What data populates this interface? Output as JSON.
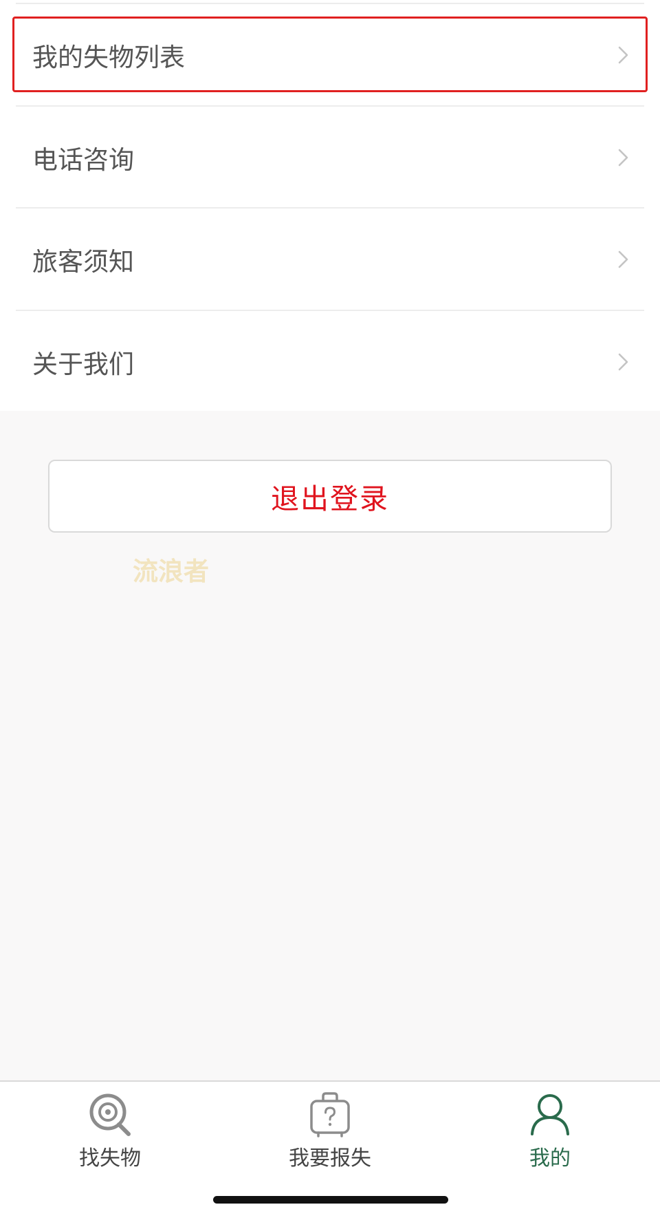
{
  "menu": {
    "items": [
      {
        "label": "我的失物列表"
      },
      {
        "label": "电话咨询"
      },
      {
        "label": "旅客须知"
      },
      {
        "label": "关于我们"
      }
    ]
  },
  "logout": {
    "label": "退出登录",
    "color": "#e0141e"
  },
  "watermark": {
    "text": "流浪者"
  },
  "tabbar": {
    "active_color": "#2a6b4c",
    "tabs": [
      {
        "label": "找失物",
        "icon": "search-lost-icon"
      },
      {
        "label": "我要报失",
        "icon": "luggage-question-icon"
      },
      {
        "label": "我的",
        "icon": "user-icon",
        "active": true
      }
    ]
  },
  "highlight": {
    "color": "#e02020"
  }
}
